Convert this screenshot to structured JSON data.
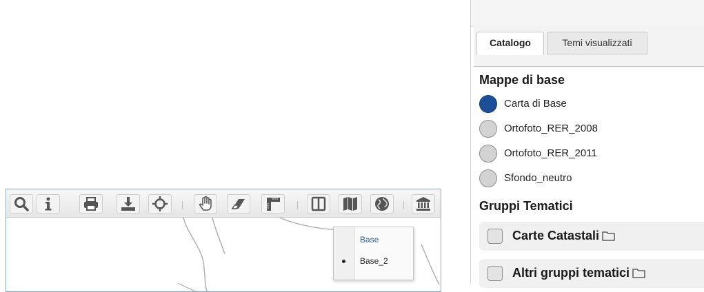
{
  "toolbar": {
    "buttons": [
      {
        "name": "search-button",
        "icon": "search-icon"
      },
      {
        "name": "info-button",
        "icon": "info-icon"
      },
      {
        "name": "print-button",
        "icon": "printer-icon"
      },
      {
        "name": "download-button",
        "icon": "download-icon"
      },
      {
        "name": "locate-button",
        "icon": "crosshair-icon"
      },
      {
        "name": "pan-button",
        "icon": "hand-icon"
      },
      {
        "name": "erase-button",
        "icon": "eraser-icon"
      },
      {
        "name": "measure-button",
        "icon": "ruler-corner-icon"
      },
      {
        "name": "split-view-button",
        "icon": "split-view-icon"
      },
      {
        "name": "basemap-button",
        "icon": "map-icon"
      },
      {
        "name": "globe-button",
        "icon": "globe-icon"
      },
      {
        "name": "cadastre-button",
        "icon": "bank-icon"
      }
    ]
  },
  "basemap_menu": {
    "items": [
      {
        "label": "Base",
        "selected": false
      },
      {
        "label": "Base_2",
        "selected": true
      }
    ]
  },
  "panel": {
    "tabs": [
      {
        "label": "Catalogo",
        "active": true
      },
      {
        "label": "Temi visualizzati",
        "active": false
      }
    ],
    "base_maps": {
      "title": "Mappe di base",
      "items": [
        {
          "label": "Carta di Base",
          "selected": true
        },
        {
          "label": "Ortofoto_RER_2008",
          "selected": false
        },
        {
          "label": "Ortofoto_RER_2011",
          "selected": false
        },
        {
          "label": "Sfondo_neutro",
          "selected": false
        }
      ]
    },
    "thematic_groups": {
      "title": "Gruppi Tematici",
      "items": [
        {
          "label": "Carte Catastali",
          "icon": "folder-icon"
        },
        {
          "label": "Altri gruppi tematici",
          "icon": "folder-icon"
        }
      ]
    }
  },
  "colors": {
    "selected_radio": "#1c4f98",
    "map_border": "#8aa6c1",
    "menu_header": "#2a5d9e"
  }
}
